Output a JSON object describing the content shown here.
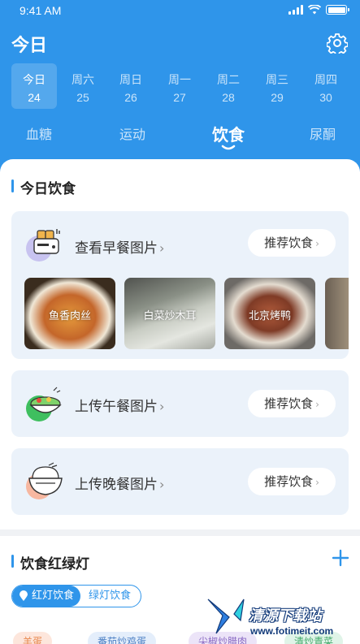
{
  "status": {
    "time": "9:41 AM"
  },
  "header": {
    "title": "今日",
    "dates": [
      {
        "weekday": "今日",
        "day": "24"
      },
      {
        "weekday": "周六",
        "day": "25"
      },
      {
        "weekday": "周日",
        "day": "26"
      },
      {
        "weekday": "周一",
        "day": "27"
      },
      {
        "weekday": "周二",
        "day": "28"
      },
      {
        "weekday": "周三",
        "day": "29"
      },
      {
        "weekday": "周四",
        "day": "30"
      }
    ],
    "tabs": [
      "血糖",
      "运动",
      "饮食",
      "尿酮"
    ]
  },
  "today_diet": {
    "title": "今日饮食",
    "breakfast": {
      "title": "查看早餐图片",
      "recommend": "推荐饮食",
      "photos": [
        "鱼香肉丝",
        "白菜炒木耳",
        "北京烤鸭"
      ]
    },
    "lunch": {
      "title": "上传午餐图片",
      "recommend": "推荐饮食"
    },
    "dinner": {
      "title": "上传晚餐图片",
      "recommend": "推荐饮食"
    }
  },
  "lights": {
    "title": "饮食红绿灯",
    "toggle_red": "红灯饮食",
    "toggle_green": "绿灯饮食",
    "chips": [
      "羊蛋",
      "番茄炒鸡蛋",
      "尖椒炒腊肉",
      "清炒青菜"
    ]
  },
  "watermark": {
    "name": "清源下载站",
    "url": "www.fotimeit.com"
  },
  "colors": {
    "primary": "#2f95ea",
    "card_bg": "#ebf2fa"
  }
}
